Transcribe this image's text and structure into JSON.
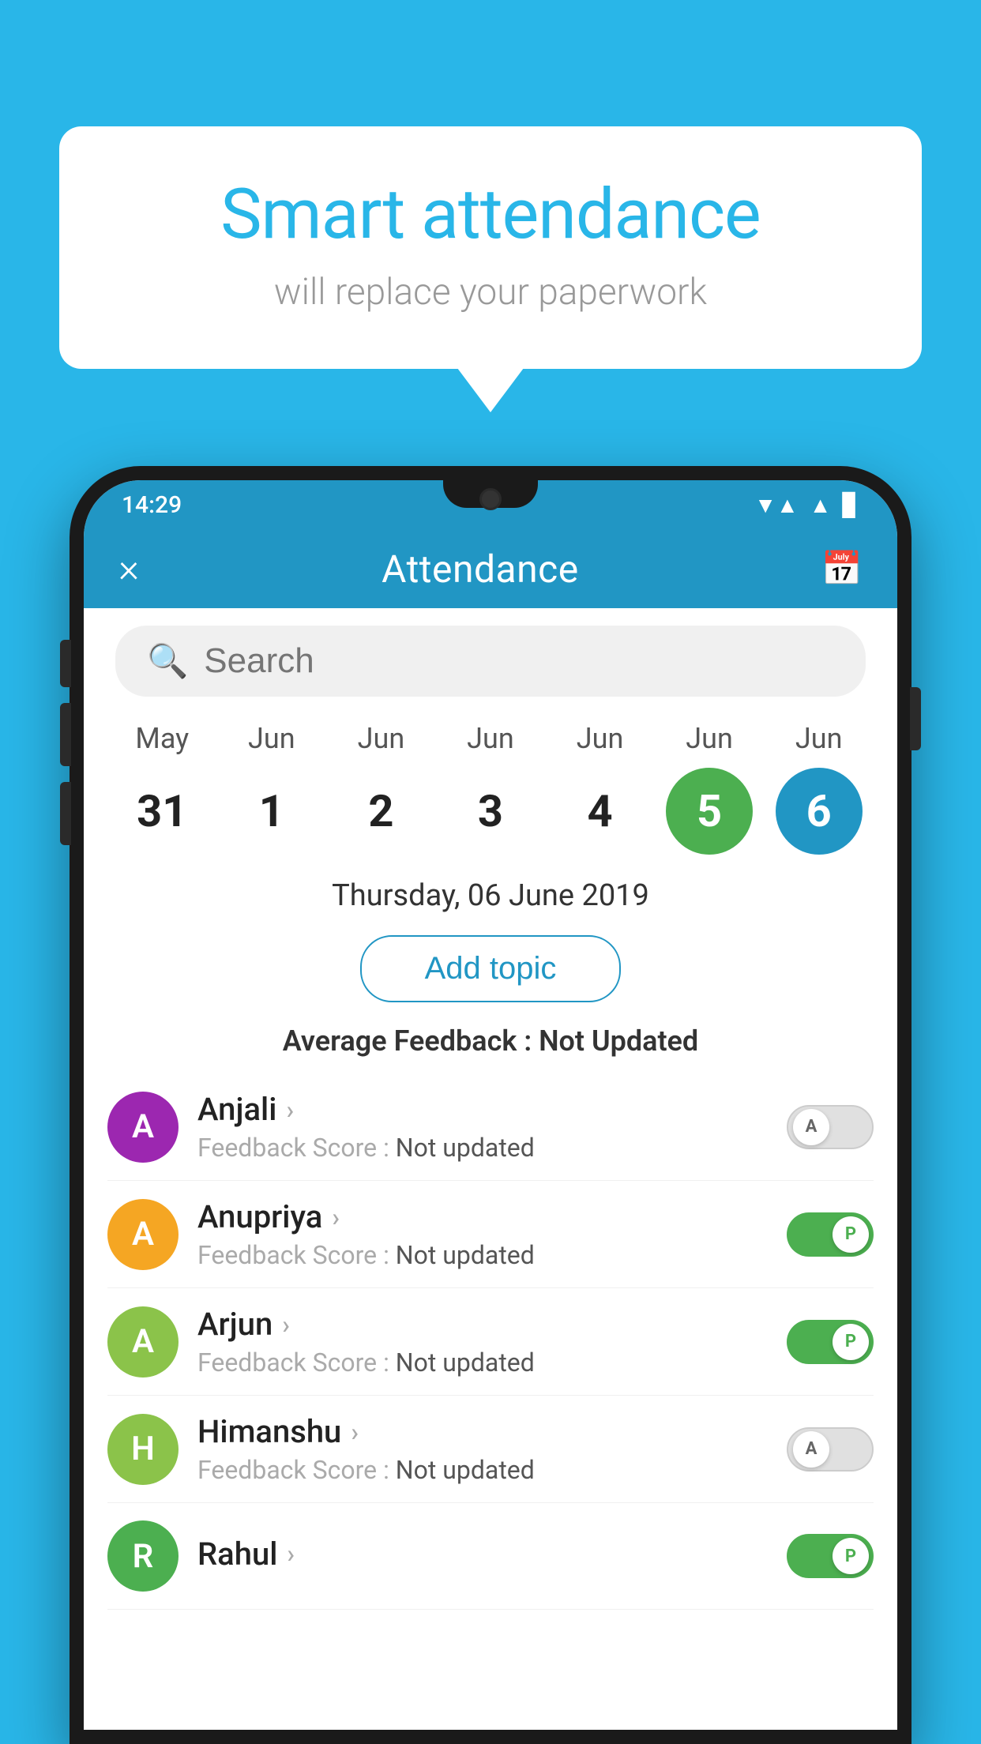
{
  "background_color": "#29b6e8",
  "speech_bubble": {
    "title": "Smart attendance",
    "subtitle": "will replace your paperwork"
  },
  "status_bar": {
    "time": "14:29",
    "icons": [
      "wifi",
      "signal",
      "battery"
    ]
  },
  "header": {
    "title": "Attendance",
    "close_label": "×",
    "calendar_icon": "calendar"
  },
  "search": {
    "placeholder": "Search"
  },
  "dates": [
    {
      "month": "May",
      "day": "31",
      "style": "normal"
    },
    {
      "month": "Jun",
      "day": "1",
      "style": "normal"
    },
    {
      "month": "Jun",
      "day": "2",
      "style": "normal"
    },
    {
      "month": "Jun",
      "day": "3",
      "style": "normal"
    },
    {
      "month": "Jun",
      "day": "4",
      "style": "normal"
    },
    {
      "month": "Jun",
      "day": "5",
      "style": "green"
    },
    {
      "month": "Jun",
      "day": "6",
      "style": "blue"
    }
  ],
  "selected_date": "Thursday, 06 June 2019",
  "add_topic_label": "Add topic",
  "avg_feedback_label": "Average Feedback :",
  "avg_feedback_value": "Not Updated",
  "students": [
    {
      "name": "Anjali",
      "feedback": "Not updated",
      "avatar_letter": "A",
      "avatar_color": "#9c27b0",
      "toggle": "off",
      "toggle_label": "A"
    },
    {
      "name": "Anupriya",
      "feedback": "Not updated",
      "avatar_letter": "A",
      "avatar_color": "#f5a623",
      "toggle": "on",
      "toggle_label": "P"
    },
    {
      "name": "Arjun",
      "feedback": "Not updated",
      "avatar_letter": "A",
      "avatar_color": "#8bc34a",
      "toggle": "on",
      "toggle_label": "P"
    },
    {
      "name": "Himanshu",
      "feedback": "Not updated",
      "avatar_letter": "H",
      "avatar_color": "#8bc34a",
      "toggle": "off",
      "toggle_label": "A"
    },
    {
      "name": "Rahul",
      "feedback": "",
      "avatar_letter": "R",
      "avatar_color": "#4caf50",
      "toggle": "on",
      "toggle_label": "P"
    }
  ]
}
